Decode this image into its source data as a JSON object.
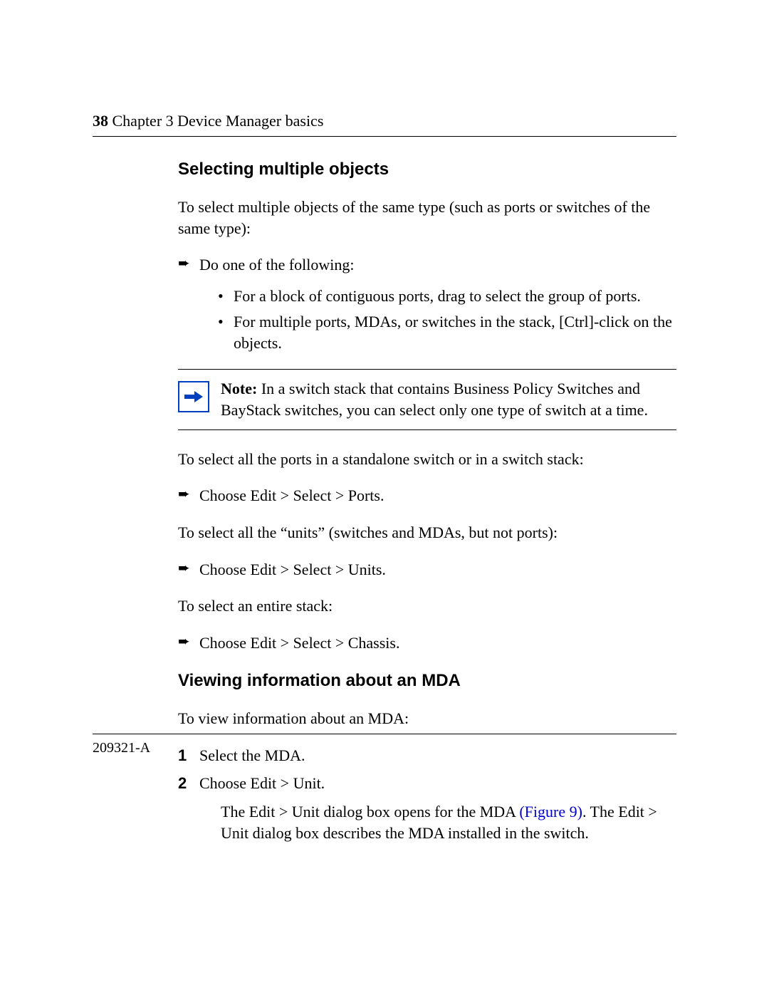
{
  "header": {
    "page_number": "38",
    "chapter": "Chapter 3  Device Manager basics"
  },
  "section1": {
    "heading": "Selecting multiple objects",
    "intro": "To select multiple objects of the same type (such as ports or switches of the same type):",
    "do_one": "Do one of the following:",
    "bullet_a": "For a block of contiguous ports, drag to select the group of ports.",
    "bullet_b": "For multiple ports, MDAs, or switches in the stack, [Ctrl]-click on the objects.",
    "note_label": "Note:",
    "note_text": " In a switch stack that contains Business Policy Switches and BayStack switches, you can select only one type of switch at a time.",
    "p2": "To select all the ports in a standalone switch or in a switch stack:",
    "step2": "Choose Edit > Select > Ports.",
    "p3": "To select all the “units” (switches and MDAs, but not ports):",
    "step3": "Choose Edit > Select > Units.",
    "p4": "To select an entire stack:",
    "step4": "Choose Edit > Select > Chassis."
  },
  "section2": {
    "heading": "Viewing information about an MDA",
    "intro": "To view information about an MDA:",
    "step1": "Select the MDA.",
    "step2": "Choose Edit > Unit.",
    "result_a": "The Edit > Unit dialog box opens for the MDA ",
    "figure_ref": "(Figure 9)",
    "result_b": ". The Edit > Unit dialog box describes the MDA installed in the switch."
  },
  "footer": {
    "doc_id": "209321-A"
  }
}
